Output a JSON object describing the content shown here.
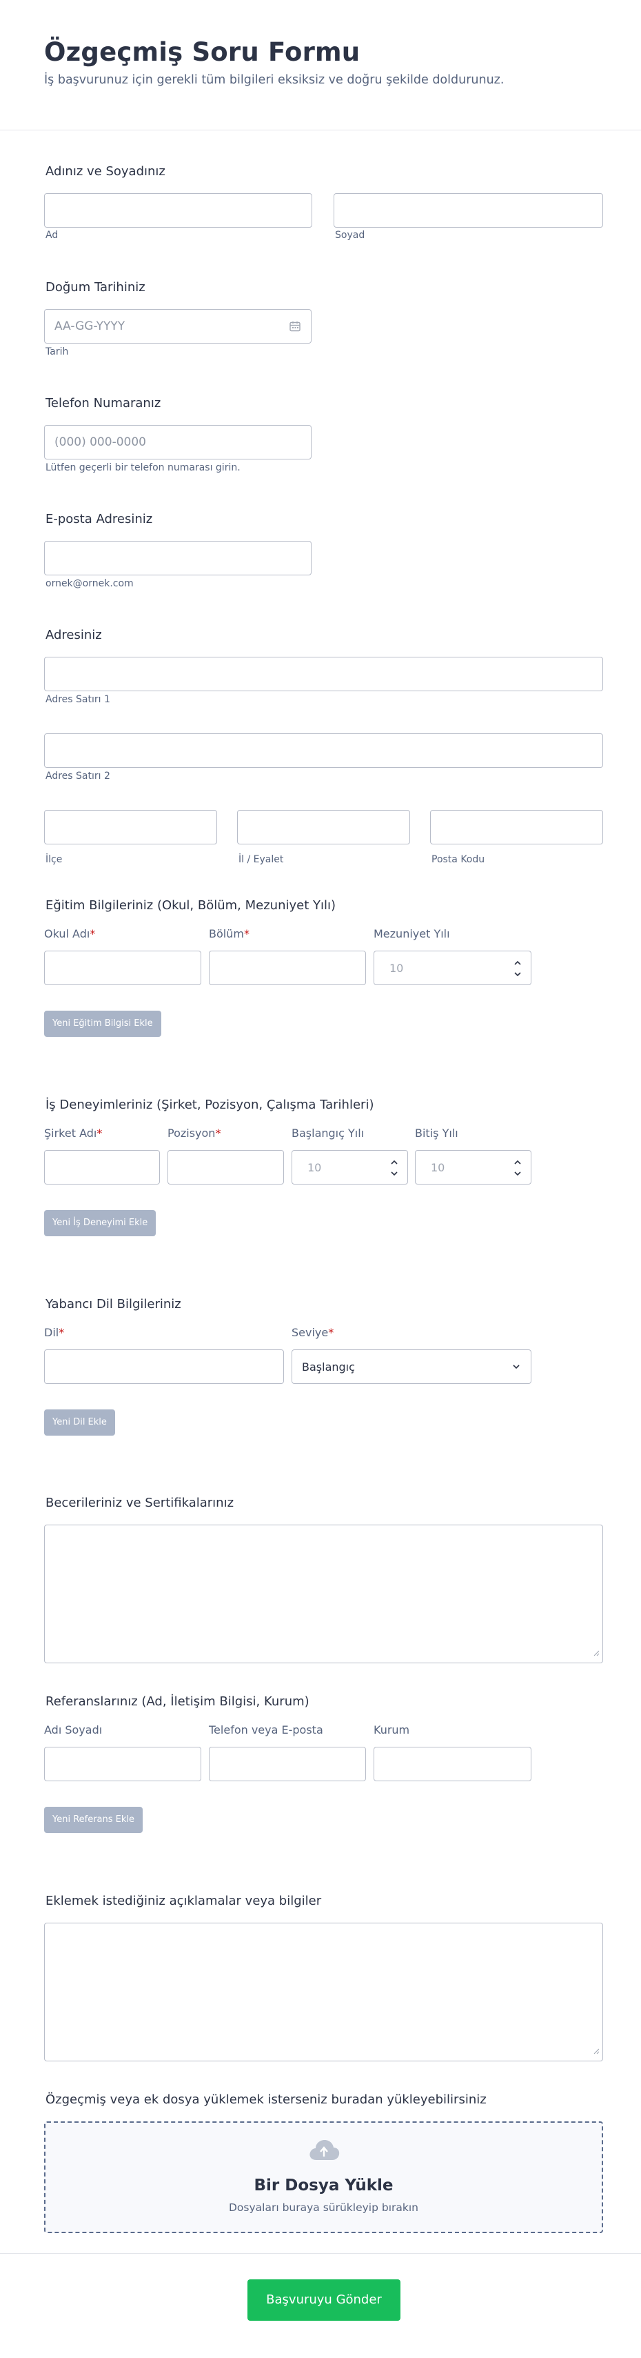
{
  "header": {
    "title": "Özgeçmiş Soru Formu",
    "subtitle": "İş başvurunuz için gerekli tüm bilgileri eksiksiz ve doğru şekilde doldurunuz."
  },
  "name": {
    "label": "Adınız ve Soyadınız",
    "first_sub": "Ad",
    "last_sub": "Soyad"
  },
  "birth": {
    "label": "Doğum Tarihiniz",
    "placeholder": "AA-GG-YYYY",
    "sub": "Tarih"
  },
  "phone": {
    "label": "Telefon Numaranız",
    "placeholder": "(000) 000-0000",
    "sub": "Lütfen geçerli bir telefon numarası girin."
  },
  "email": {
    "label": "E-posta Adresiniz",
    "sub": "ornek@ornek.com"
  },
  "address": {
    "label": "Adresiniz",
    "line1_sub": "Adres Satırı 1",
    "line2_sub": "Adres Satırı 2",
    "district_sub": "İlçe",
    "province_sub": "İl / Eyalet",
    "postal_sub": "Posta Kodu"
  },
  "education": {
    "label": "Eğitim Bilgileriniz (Okul, Bölüm, Mezuniyet Yılı)",
    "col_school": "Okul Adı",
    "col_dept": "Bölüm",
    "col_year": "Mezuniyet Yılı",
    "year_placeholder": "10",
    "add_button": "Yeni Eğitim Bilgisi Ekle"
  },
  "experience": {
    "label": "İş Deneyimleriniz (Şirket, Pozisyon, Çalışma Tarihleri)",
    "col_company": "Şirket Adı",
    "col_position": "Pozisyon",
    "col_start": "Başlangıç Yılı",
    "col_end": "Bitiş Yılı",
    "start_placeholder": "10",
    "end_placeholder": "10",
    "add_button": "Yeni İş Deneyimi Ekle"
  },
  "language": {
    "label": "Yabancı Dil Bilgileriniz",
    "col_lang": "Dil",
    "col_level": "Seviye",
    "level_value": "Başlangıç",
    "add_button": "Yeni Dil Ekle"
  },
  "skills": {
    "label": "Becerileriniz ve Sertifikalarınız"
  },
  "references": {
    "label": "Referanslarınız (Ad, İletişim Bilgisi, Kurum)",
    "col_name": "Adı Soyadı",
    "col_contact": "Telefon veya E-posta",
    "col_org": "Kurum",
    "add_button": "Yeni Referans Ekle"
  },
  "notes": {
    "label": "Eklemek istediğiniz açıklamalar veya bilgiler"
  },
  "upload": {
    "label": "Özgeçmiş veya ek dosya yüklemek isterseniz buradan yükleyebilirsiniz",
    "title": "Bir Dosya Yükle",
    "hint": "Dosyaları buraya sürükleyip bırakın",
    "icon": "cloud-upload-icon"
  },
  "submit": {
    "label": "Başvuruyu Gönder"
  },
  "colors": {
    "submit": "#18bd5b",
    "add_button": "#a9b4c7",
    "required": "#c51717"
  }
}
